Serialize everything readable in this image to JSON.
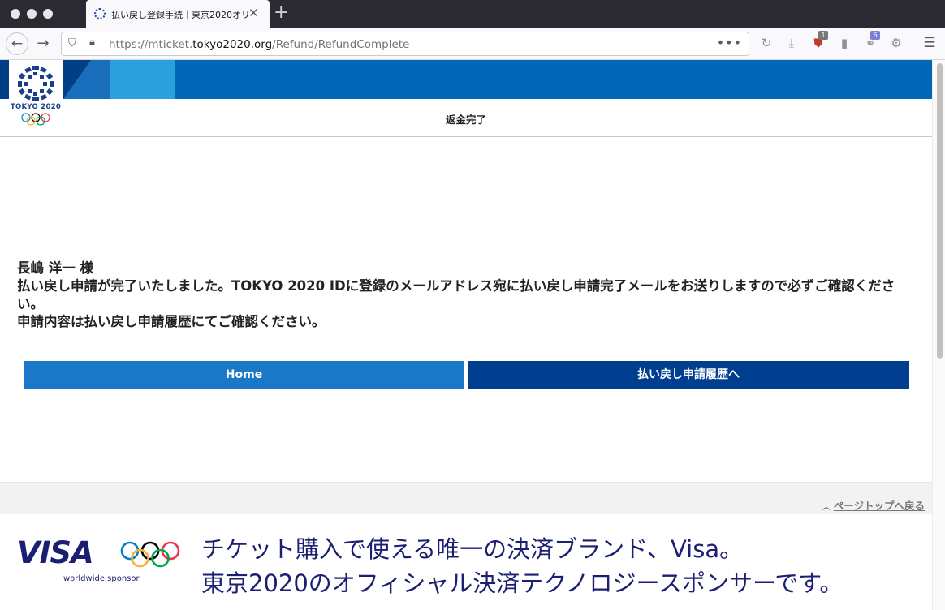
{
  "browser": {
    "tab_title": "払い戻し登録手続｜東京2020オリ",
    "url_prefix": "https://mticket.",
    "url_domain": "tokyo2020.org",
    "url_path": "/Refund/RefundComplete",
    "badge_ublock": "1",
    "badge_ext": "6"
  },
  "header": {
    "logo_text": "TOKYO 2020",
    "page_title": "返金完了"
  },
  "message": {
    "greeting": "長嶋 洋一 様",
    "line1": "払い戻し申請が完了いたしました。TOKYO 2020 IDに登録のメールアドレス宛に払い戻し申請完了メールをお送りしますので必ずご確認ください。",
    "line2": "申請内容は払い戻し申請履歴にてご確認ください。"
  },
  "buttons": {
    "home": "Home",
    "history": "払い戻し申請履歴へ"
  },
  "footer": {
    "page_top": "ページトップへ戻る"
  },
  "banner": {
    "brand": "VISA",
    "sponsor": "worldwide sponsor",
    "line1": "チケット購入で使える唯一の決済ブランド、Visa。",
    "line2": "東京2020のオフィシャル決済テクノロジースポンサーです。"
  },
  "colors": {
    "header_blue": "#0068b7",
    "button_home": "#1a78c6",
    "button_history": "#003f8f",
    "visa_navy": "#1a1f71"
  }
}
